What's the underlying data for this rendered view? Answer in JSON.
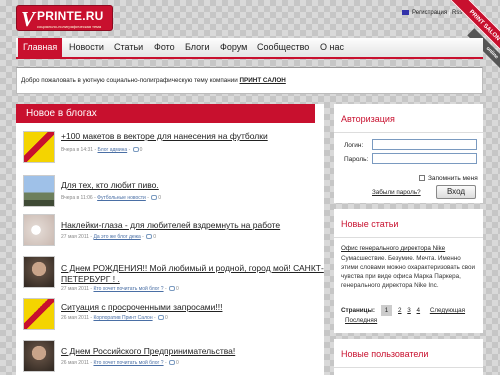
{
  "brand": {
    "v": "V",
    "name": "PRINTE.RU",
    "tagline": "социально-полиграфическая тема"
  },
  "topright": {
    "register": "Регистрация",
    "rss": "Rss"
  },
  "ribbon": {
    "main": "PRINT SALON",
    "side": "online"
  },
  "nav": [
    {
      "label": "Главная",
      "active": true
    },
    {
      "label": "Новости"
    },
    {
      "label": "Статьи"
    },
    {
      "label": "Фото"
    },
    {
      "label": "Блоги"
    },
    {
      "label": "Форум"
    },
    {
      "label": "Сообщество"
    },
    {
      "label": "О нас"
    }
  ],
  "welcome": {
    "text": "Добро пожаловать в уютную социально-полиграфическую тему компании ",
    "link": "ПРИНТ САЛОН"
  },
  "blogs": {
    "title": "Новое в блогах",
    "posts": [
      {
        "title": "+100 макетов в векторе для нанесения на футболки",
        "date": "Вчера в 14:31 - ",
        "blog": "Блог админа",
        "comments": "0"
      },
      {
        "title": "Для тех, кто любит пиво.",
        "date": "Вчера в 11:06 - ",
        "blog": "Футбольные новости",
        "comments": "0"
      },
      {
        "title": "Наклейки-глаза - для любителей вздремнуть на работе",
        "date": "27 мая 2011 - ",
        "blog": "Да это же блог дежа",
        "comments": "0"
      },
      {
        "title": "С Днем РОЖДЕНИЯ!! Мой любимый и родной, город мой! САНКТ-",
        "title2": "ПЕТЕРБУРГ ! .",
        "date": "27 мая 2011 - ",
        "blog": "Кто хочет почитать мой блог ?",
        "comments": "0"
      },
      {
        "title": "Ситуация с просроченными запросами!!!",
        "date": "26 мая 2011 - ",
        "blog": "Корпоратив Принт Салон",
        "comments": "0"
      },
      {
        "title": "С Днем Российского Предпринимательства!",
        "date": "26 мая 2011 - ",
        "blog": "Кто хочет почитать мой блог ?",
        "comments": "0"
      }
    ]
  },
  "auth": {
    "title": "Авторизация",
    "login_label": "Логин:",
    "password_label": "Пароль:",
    "remember_label": "Запомнить меня",
    "forgot": "Забыли пароль?",
    "submit": "Вход"
  },
  "articles": {
    "title": "Новые статьи",
    "link": "Офис генерального директора Nike",
    "text": "Сумасшествие. Безумие. Мечта. Именно этими словами можно охарактеризовать свои чувства при виде офиса Марка Паркера, генерального директора Nike Inc.",
    "pages_label": "Страницы:",
    "pages": [
      "1",
      "2",
      "3",
      "4"
    ],
    "next": "Следующая",
    "last": "Последняя"
  },
  "users": {
    "title": "Новые пользователи"
  }
}
